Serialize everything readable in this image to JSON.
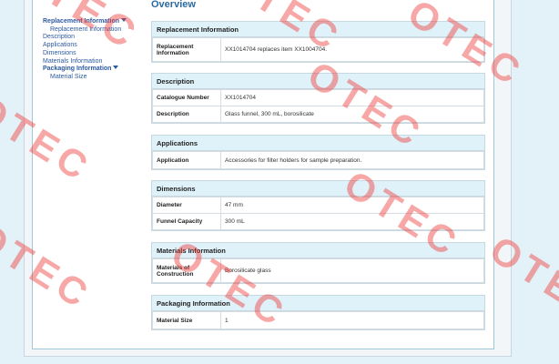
{
  "page_title": "Overview",
  "sidebar": {
    "items": [
      {
        "label": "Replacement Information",
        "bold": true,
        "indent": false,
        "expanded": true
      },
      {
        "label": "Replacement Information",
        "bold": false,
        "indent": true
      },
      {
        "label": "Description",
        "bold": false,
        "indent": false
      },
      {
        "label": "Applications",
        "bold": false,
        "indent": false
      },
      {
        "label": "Dimensions",
        "bold": false,
        "indent": false
      },
      {
        "label": "Materials Information",
        "bold": false,
        "indent": false
      },
      {
        "label": "Packaging Information",
        "bold": true,
        "indent": false,
        "expanded": true
      },
      {
        "label": "Material Size",
        "bold": false,
        "indent": true
      }
    ]
  },
  "sections": {
    "replacement": {
      "title": "Replacement Information",
      "rows": [
        {
          "label": "Replacement Information",
          "value": "XX1014704 replaces item XX1004704."
        }
      ]
    },
    "description": {
      "title": "Description",
      "rows": [
        {
          "label": "Catalogue Number",
          "value": "XX1014704"
        },
        {
          "label": "Description",
          "value": "Glass funnel, 300 mL, borosilicate"
        }
      ]
    },
    "applications": {
      "title": "Applications",
      "rows": [
        {
          "label": "Application",
          "value": "Accessories for filter holders for sample preparation."
        }
      ]
    },
    "dimensions": {
      "title": "Dimensions",
      "rows": [
        {
          "label": "Diameter",
          "value": "47 mm"
        },
        {
          "label": "Funnel Capacity",
          "value": "300 mL"
        }
      ]
    },
    "materials": {
      "title": "Materials Information",
      "rows": [
        {
          "label": "Materials of Construction",
          "value": "Borosilicate glass"
        }
      ]
    },
    "packaging": {
      "title": "Packaging Information",
      "rows": [
        {
          "label": "Material Size",
          "value": "1"
        }
      ]
    }
  },
  "watermark": {
    "text": "OTEC",
    "color": "#f03c3c"
  },
  "colors": {
    "link": "#2c5aa0",
    "header_bg": "#dff2fa",
    "title": "#2c6aa0"
  }
}
